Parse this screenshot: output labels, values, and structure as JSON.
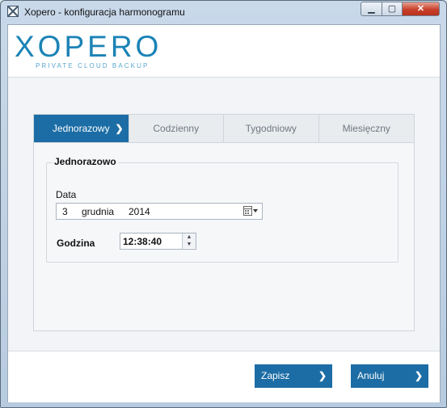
{
  "window": {
    "title": "Xopero - konfiguracja  harmonogramu",
    "icon": "app-icon",
    "buttons": {
      "minimize": "▁",
      "maximize": "▢",
      "close": "✕"
    }
  },
  "logo": {
    "main": "XOPERO",
    "sub": "PRIVATE CLOUD BACKUP",
    "color": "#1b83b6"
  },
  "tabs": [
    {
      "label": "Jednorazowy",
      "active": true,
      "chevron": "❯"
    },
    {
      "label": "Codzienny",
      "active": false
    },
    {
      "label": "Tygodniowy",
      "active": false
    },
    {
      "label": "Miesięczny",
      "active": false
    }
  ],
  "panel": {
    "group_title": "Jednorazowo",
    "date_label": "Data",
    "date": {
      "day": "3",
      "month": "grudnia",
      "year": "2014"
    },
    "time_label": "Godzina",
    "time_value": "12:38:40"
  },
  "footer": {
    "save_label": "Zapisz",
    "cancel_label": "Anuluj",
    "chevron": "❯",
    "accent": "#1c6da5"
  }
}
